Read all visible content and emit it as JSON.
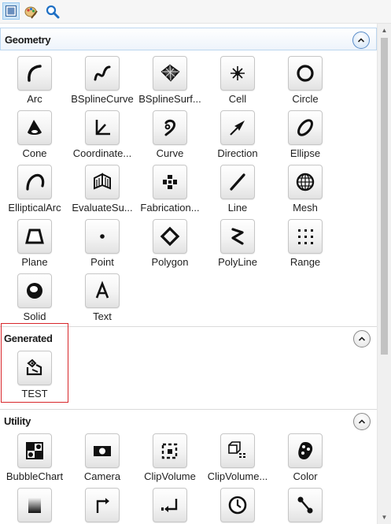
{
  "toolbar": {
    "buttons": [
      {
        "icon": "view-icon",
        "active": true
      },
      {
        "icon": "palette-icon",
        "active": false
      },
      {
        "icon": "search-icon",
        "active": false
      }
    ]
  },
  "sections": [
    {
      "title": "Geometry",
      "items": [
        {
          "label": "Arc",
          "icon": "arc-icon"
        },
        {
          "label": "BSplineCurve",
          "icon": "bspline-curve-icon"
        },
        {
          "label": "BSplineSurf...",
          "icon": "bspline-surface-icon"
        },
        {
          "label": "Cell",
          "icon": "cell-icon"
        },
        {
          "label": "Circle",
          "icon": "circle-icon"
        },
        {
          "label": "Cone",
          "icon": "cone-icon"
        },
        {
          "label": "Coordinate...",
          "icon": "coordinate-icon"
        },
        {
          "label": "Curve",
          "icon": "curve-icon"
        },
        {
          "label": "Direction",
          "icon": "direction-icon"
        },
        {
          "label": "Ellipse",
          "icon": "ellipse-icon"
        },
        {
          "label": "EllipticalArc",
          "icon": "elliptical-arc-icon"
        },
        {
          "label": "EvaluateSu...",
          "icon": "evaluate-surface-icon"
        },
        {
          "label": "Fabrication...",
          "icon": "fabrication-icon"
        },
        {
          "label": "Line",
          "icon": "line-icon"
        },
        {
          "label": "Mesh",
          "icon": "mesh-icon"
        },
        {
          "label": "Plane",
          "icon": "plane-icon"
        },
        {
          "label": "Point",
          "icon": "point-icon"
        },
        {
          "label": "Polygon",
          "icon": "polygon-icon"
        },
        {
          "label": "PolyLine",
          "icon": "polyline-icon"
        },
        {
          "label": "Range",
          "icon": "range-icon"
        },
        {
          "label": "Solid",
          "icon": "solid-icon"
        },
        {
          "label": "Text",
          "icon": "text-icon"
        }
      ]
    },
    {
      "title": "Generated",
      "items": [
        {
          "label": "TEST",
          "icon": "test-node-icon"
        }
      ]
    },
    {
      "title": "Utility",
      "items": [
        {
          "label": "BubbleChart",
          "icon": "bubble-chart-icon"
        },
        {
          "label": "Camera",
          "icon": "camera-icon"
        },
        {
          "label": "ClipVolume",
          "icon": "clip-volume-icon"
        },
        {
          "label": "ClipVolume...",
          "icon": "clip-volume-plane-icon"
        },
        {
          "label": "Color",
          "icon": "color-icon"
        },
        {
          "label": "",
          "icon": "gradient-icon"
        },
        {
          "label": "",
          "icon": "export-icon"
        },
        {
          "label": "",
          "icon": "import-icon"
        },
        {
          "label": "",
          "icon": "clock-icon"
        },
        {
          "label": "",
          "icon": "connect-icon"
        }
      ]
    }
  ],
  "colors": {
    "accent": "#99c9ef",
    "highlight": "#d8262a",
    "icon": "#111111"
  }
}
